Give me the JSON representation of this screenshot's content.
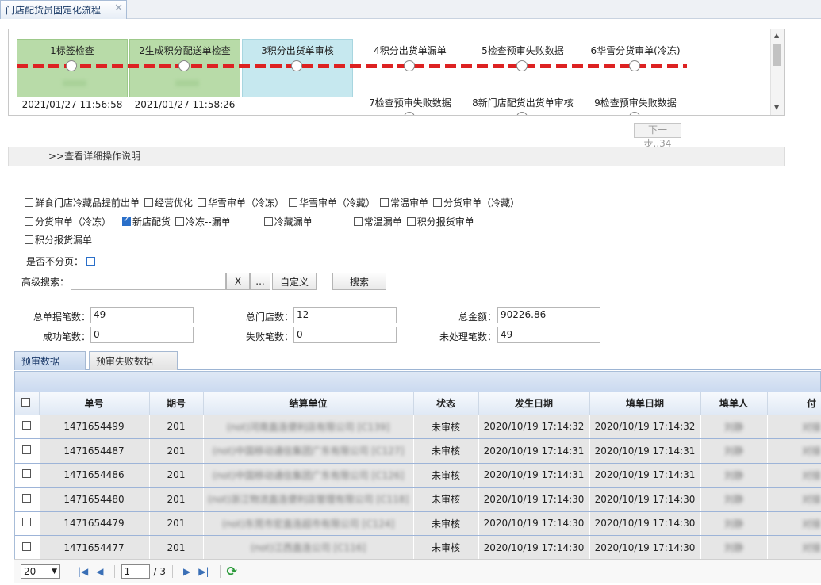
{
  "window": {
    "tab_title": "门店配货员固定化流程",
    "close_glyph": "✕"
  },
  "flow": {
    "steps_row1": [
      {
        "label": "1标签检查",
        "time": "2021/01/27 11:56:58",
        "state": "done"
      },
      {
        "label": "2生成积分配送单检查",
        "time": "2021/01/27 11:58:26",
        "state": "done"
      },
      {
        "label": "3积分出货单审核",
        "time": "",
        "state": "current"
      },
      {
        "label": "4积分出货单漏单",
        "time": "",
        "state": "pending"
      },
      {
        "label": "5检查预审失败数据",
        "time": "",
        "state": "pending"
      },
      {
        "label": "6华雪分货审单(冷冻)",
        "time": "",
        "state": "pending"
      }
    ],
    "steps_row2": [
      {
        "label": "7检查预审失败数据"
      },
      {
        "label": "8新门店配货出货单审核"
      },
      {
        "label": "9检查预审失败数据"
      }
    ],
    "next_button": "下一步..34"
  },
  "help": {
    "label": ">>查看详细操作说明"
  },
  "filters": {
    "row1": [
      {
        "label": "鲜食门店冷藏品提前出单",
        "checked": false
      },
      {
        "label": "经营优化",
        "checked": false
      },
      {
        "label": "华雪审单（冷冻）",
        "checked": false
      },
      {
        "label": "华雪审单（冷藏）",
        "checked": false
      },
      {
        "label": "常温审单",
        "checked": false
      },
      {
        "label": "分货审单（冷藏）",
        "checked": false
      }
    ],
    "row2": [
      {
        "label": "分货审单（冷冻）",
        "checked": false
      },
      {
        "label": "新店配货",
        "checked": true
      },
      {
        "label": "冷冻--漏单",
        "checked": false
      },
      {
        "label": "冷藏漏单",
        "checked": false
      },
      {
        "label": "常温漏单",
        "checked": false
      },
      {
        "label": "积分报货审单",
        "checked": false
      }
    ],
    "row3": [
      {
        "label": "积分报货漏单",
        "checked": false
      }
    ],
    "no_paging_label": "是否不分页："
  },
  "search": {
    "label": "高级搜索：",
    "value": "",
    "clear_btn": "X",
    "more_btn": "...",
    "custom_btn": "自定义",
    "search_btn": "搜索"
  },
  "summary": {
    "total_orders_label": "总单据笔数：",
    "total_orders": "49",
    "total_stores_label": "总门店数：",
    "total_stores": "12",
    "total_amount_label": "总金额：",
    "total_amount": "90226.86",
    "success_label": "成功笔数：",
    "success": "0",
    "fail_label": "失败笔数：",
    "fail": "0",
    "unprocessed_label": "未处理笔数：",
    "unprocessed": "49"
  },
  "subtabs": [
    {
      "label": "预审数据",
      "active": true
    },
    {
      "label": "预审失败数据",
      "active": false
    }
  ],
  "grid": {
    "headers": [
      "单号",
      "期号",
      "结算单位",
      "状态",
      "发生日期",
      "填单日期",
      "填单人",
      "付"
    ],
    "rows": [
      {
        "no": "1471654499",
        "period": "201",
        "unit": "(not)河南直连便利店有限公司 [C139]",
        "status": "未审核",
        "occur": "2020/10/19 17:14:32",
        "fill": "2020/10/19 17:14:32",
        "user": "刘静",
        "extra": "对接"
      },
      {
        "no": "1471654487",
        "period": "201",
        "unit": "(not)中国移动通信集团广东有限公司 [C127]",
        "status": "未审核",
        "occur": "2020/10/19 17:14:31",
        "fill": "2020/10/19 17:14:31",
        "user": "刘静",
        "extra": "对接"
      },
      {
        "no": "1471654486",
        "period": "201",
        "unit": "(not)中国移动通信集团广东有限公司 [C126]",
        "status": "未审核",
        "occur": "2020/10/19 17:14:31",
        "fill": "2020/10/19 17:14:31",
        "user": "刘静",
        "extra": "对接"
      },
      {
        "no": "1471654480",
        "period": "201",
        "unit": "(not)浙江物流直连便利店管理有限公司 [C118]",
        "status": "未审核",
        "occur": "2020/10/19 17:14:30",
        "fill": "2020/10/19 17:14:30",
        "user": "刘静",
        "extra": "对接"
      },
      {
        "no": "1471654479",
        "period": "201",
        "unit": "(not)东莞市宏直连超市有限公司 [C124]",
        "status": "未审核",
        "occur": "2020/10/19 17:14:30",
        "fill": "2020/10/19 17:14:30",
        "user": "刘静",
        "extra": "对接"
      },
      {
        "no": "1471654477",
        "period": "201",
        "unit": "(not)江西直连公司 [C116]",
        "status": "未审核",
        "occur": "2020/10/19 17:14:30",
        "fill": "2020/10/19 17:14:30",
        "user": "刘静",
        "extra": "对接"
      }
    ]
  },
  "pager": {
    "page_size": "20",
    "current_page": "1",
    "total_pages": "/ 3"
  }
}
